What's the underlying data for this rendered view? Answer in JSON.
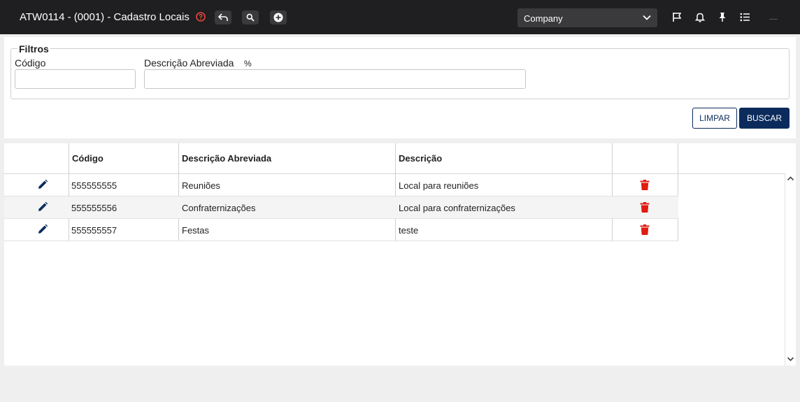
{
  "header": {
    "title": "ATW0114 - (0001) - Cadastro Locais",
    "company_select": {
      "value": "Company"
    }
  },
  "filters": {
    "legend": "Filtros",
    "codigo": {
      "label": "Código",
      "value": ""
    },
    "descricao_abreviada": {
      "label": "Descrição Abreviada",
      "hint": "%",
      "value": ""
    }
  },
  "actions": {
    "clear_label": "LIMPAR",
    "search_label": "BUSCAR"
  },
  "table": {
    "columns": [
      "Código",
      "Descrição Abreviada",
      "Descrição"
    ],
    "rows": [
      {
        "codigo": "555555555",
        "descricao_abreviada": "Reuniões",
        "descricao": "Local para reuniões"
      },
      {
        "codigo": "555555556",
        "descricao_abreviada": "Confraternizações",
        "descricao": "Local para confraternizações"
      },
      {
        "codigo": "555555557",
        "descricao_abreviada": "Festas",
        "descricao": "teste"
      }
    ]
  },
  "colors": {
    "topbar_bg": "#1f1f21",
    "primary": "#0b2b5c",
    "edit_icon": "#0b2b5c",
    "delete_icon": "#e01b0f",
    "help_icon": "#e8473b"
  },
  "icons": {
    "help": "help-icon",
    "undo": "undo-icon",
    "search": "search-icon",
    "add": "add-circle-icon",
    "flag": "flag-icon",
    "bell": "bell-icon",
    "pin": "pin-icon",
    "list": "list-icon",
    "edit": "pencil-icon",
    "delete": "trash-icon"
  }
}
